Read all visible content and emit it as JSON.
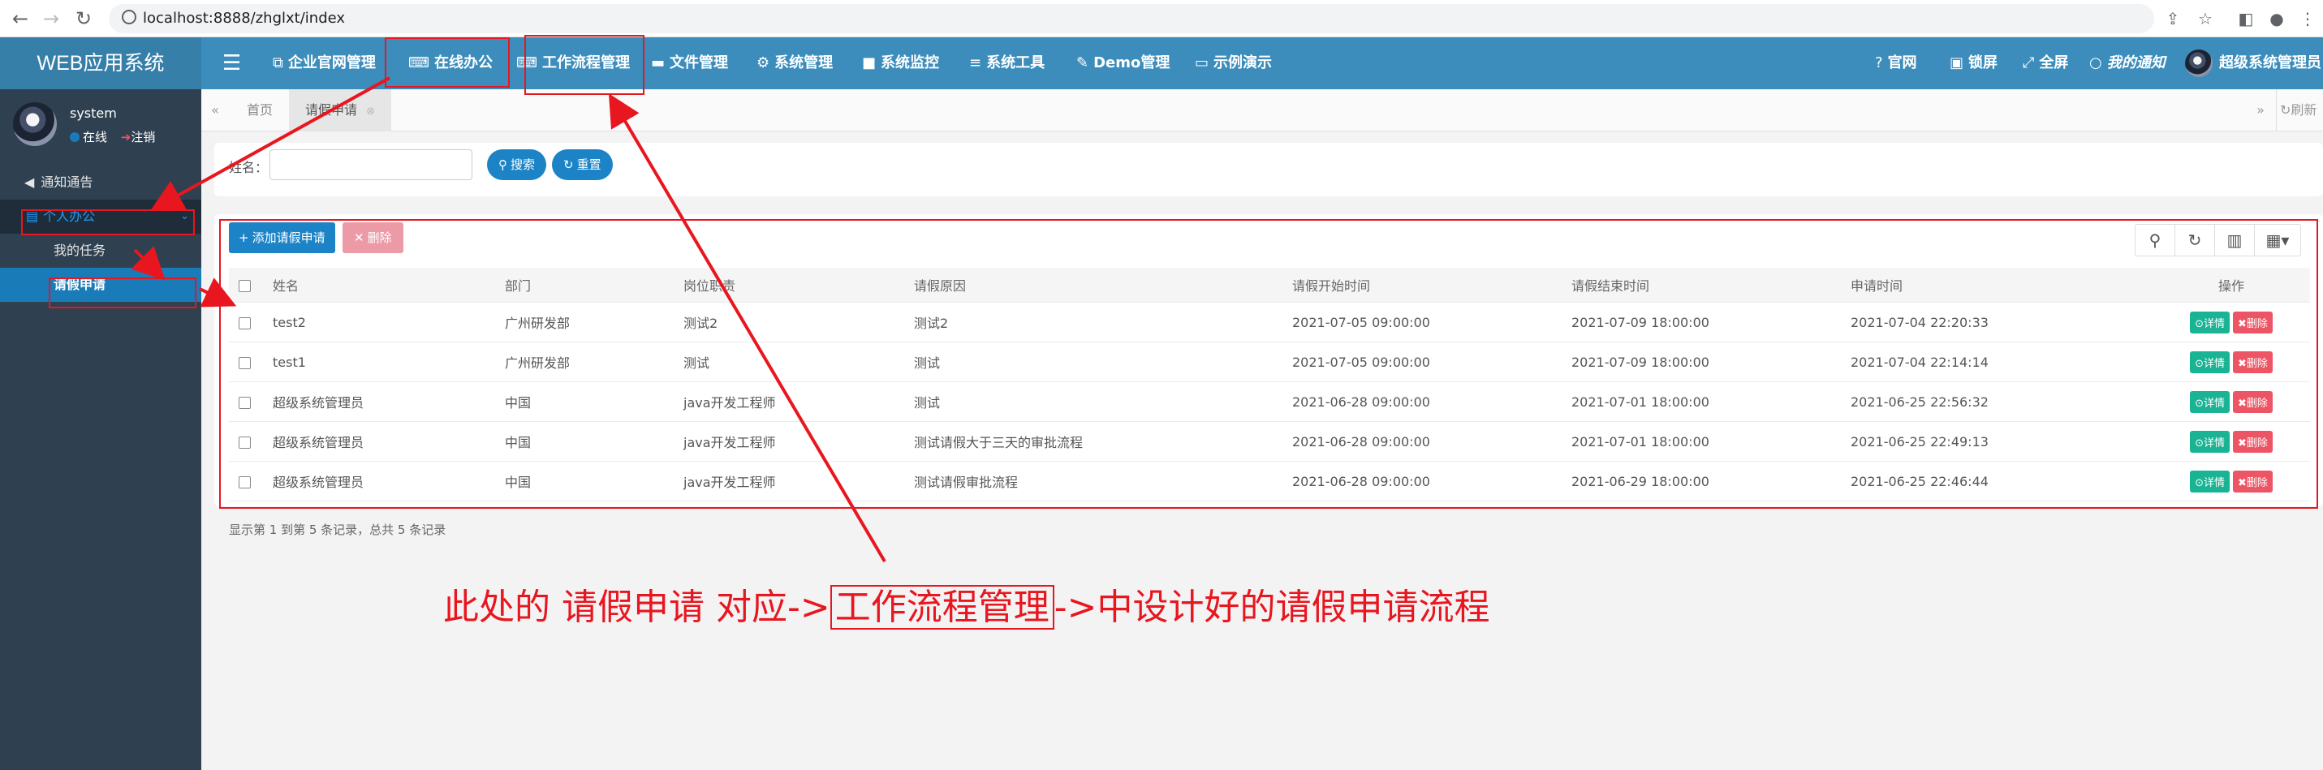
{
  "browser": {
    "url": "localhost:8888/zhglxt/index"
  },
  "app": {
    "brand": "WEB应用系统"
  },
  "top_nav": {
    "items": [
      {
        "label": "企业官网管理",
        "icon": "copy-icon"
      },
      {
        "label": "在线办公",
        "icon": "keyboard-icon"
      },
      {
        "label": "工作流程管理",
        "icon": "keyboard-icon"
      },
      {
        "label": "文件管理",
        "icon": "folder-icon"
      },
      {
        "label": "系统管理",
        "icon": "gear-icon"
      },
      {
        "label": "系统监控",
        "icon": "video-icon"
      },
      {
        "label": "系统工具",
        "icon": "bars-icon"
      },
      {
        "label": "Demo管理",
        "icon": "edit-icon"
      },
      {
        "label": "示例演示",
        "icon": "desktop-icon"
      }
    ],
    "right": {
      "official_site": "官网",
      "lock": "锁屏",
      "fullscreen": "全屏",
      "notifications": "我的通知",
      "user": "超级系统管理员"
    }
  },
  "sidebar": {
    "user_name": "system",
    "status_online": "在线",
    "logout": "注销",
    "items": [
      {
        "label": "通知通告"
      },
      {
        "label": "个人办公"
      },
      {
        "label": "我的任务"
      },
      {
        "label": "请假申请"
      }
    ]
  },
  "tabs": {
    "home": "首页",
    "leave": "请假申请",
    "refresh": "刷新"
  },
  "search": {
    "name_label": "姓名：",
    "search_button": "搜索",
    "reset_button": "重置"
  },
  "toolbar": {
    "add_label": "添加请假申请",
    "delete_label": "删除"
  },
  "table": {
    "columns": [
      "姓名",
      "部门",
      "岗位职责",
      "请假原因",
      "请假开始时间",
      "请假结束时间",
      "申请时间",
      "操作"
    ],
    "detail_label": "详情",
    "delete_label": "删除",
    "rows": [
      [
        "test2",
        "广州研发部",
        "测试2",
        "测试2",
        "2021-07-05 09:00:00",
        "2021-07-09 18:00:00",
        "2021-07-04 22:20:33"
      ],
      [
        "test1",
        "广州研发部",
        "测试",
        "测试",
        "2021-07-05 09:00:00",
        "2021-07-09 18:00:00",
        "2021-07-04 22:14:14"
      ],
      [
        "超级系统管理员",
        "中国",
        "java开发工程师",
        "测试",
        "2021-06-28 09:00:00",
        "2021-07-01 18:00:00",
        "2021-06-25 22:56:32"
      ],
      [
        "超级系统管理员",
        "中国",
        "java开发工程师",
        "测试请假大于三天的审批流程",
        "2021-06-28 09:00:00",
        "2021-07-01 18:00:00",
        "2021-06-25 22:49:13"
      ],
      [
        "超级系统管理员",
        "中国",
        "java开发工程师",
        "测试请假审批流程",
        "2021-06-28 09:00:00",
        "2021-06-29 18:00:00",
        "2021-06-25 22:46:44"
      ]
    ]
  },
  "footer": {
    "records_summary": "显示第 1 到第 5 条记录，总共 5 条记录"
  },
  "annotation": {
    "prefix": "此处的 请假申请 对应->",
    "highlight": "工作流程管理",
    "suffix": "->中设计好的请假申请流程",
    "color": "#e8161f"
  }
}
